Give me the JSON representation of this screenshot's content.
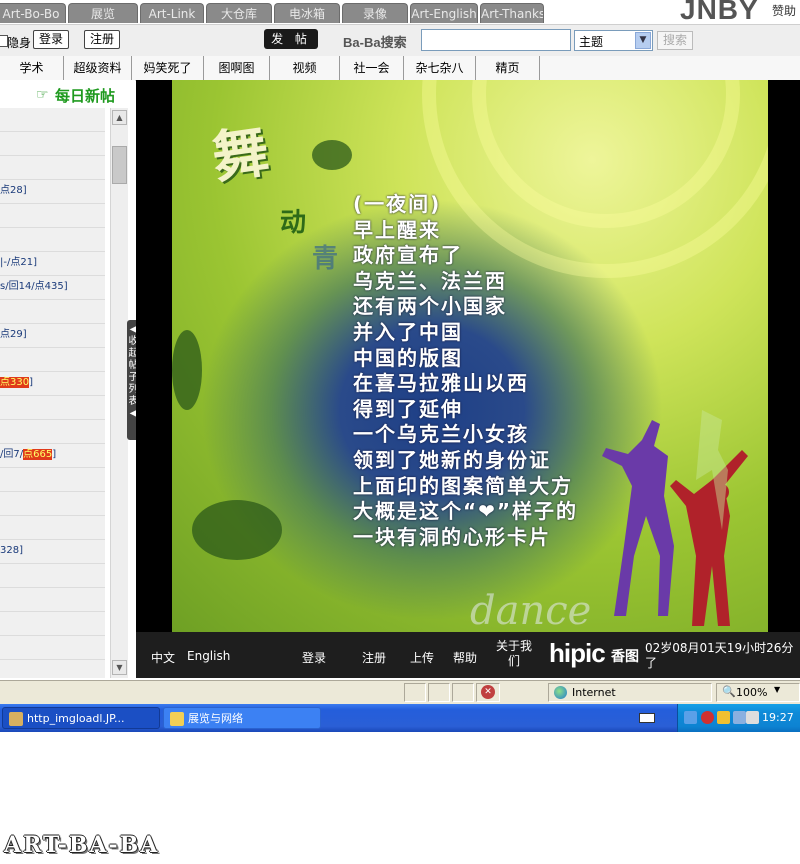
{
  "tabs": [
    "Art-Bo-Bo",
    "展览",
    "Art-Link",
    "大仓库",
    "电冰箱",
    "录像",
    "Art-English",
    "Art-Thanks"
  ],
  "brand": {
    "logo": "JNBY",
    "sponsor": "赞助"
  },
  "login_row": {
    "hidden_label": "隐身",
    "login_label": "登录",
    "register_label": "注册",
    "post_label": "发 帖",
    "search_label": "Ba-Ba搜索",
    "search_value": "",
    "scope_value": "主题",
    "search_button": "搜索"
  },
  "categories": [
    "学术",
    "超级资料",
    "妈笑死了",
    "图啊图",
    "视频",
    "社一会",
    "杂七杂八",
    "精页"
  ],
  "sidebar": {
    "title": "每日新帖",
    "collapse_label": "收起帖子列表",
    "posts": [
      {
        "text": "",
        "hl": ""
      },
      {
        "text": "",
        "hl": ""
      },
      {
        "text": "",
        "hl": ""
      },
      {
        "text": "点28]",
        "hl": ""
      },
      {
        "text": "",
        "hl": ""
      },
      {
        "text": "",
        "hl": ""
      },
      {
        "text": "|-/点21]",
        "hl": ""
      },
      {
        "text": "s/回14/点435]",
        "hl": ""
      },
      {
        "text": "",
        "hl": ""
      },
      {
        "text": "点29]",
        "hl": ""
      },
      {
        "text": "",
        "hl": ""
      },
      {
        "text": "",
        "hl": "点330",
        "tail": "]"
      },
      {
        "text": "",
        "hl": ""
      },
      {
        "text": "",
        "hl": ""
      },
      {
        "text": "/回7/",
        "hl": "点665",
        "tail": "]"
      },
      {
        "text": "",
        "hl": ""
      },
      {
        "text": "",
        "hl": ""
      },
      {
        "text": "",
        "hl": ""
      },
      {
        "text": "328]",
        "hl": ""
      },
      {
        "text": "",
        "hl": ""
      },
      {
        "text": "",
        "hl": ""
      },
      {
        "text": "",
        "hl": ""
      },
      {
        "text": "",
        "hl": ""
      },
      {
        "text": "",
        "hl": ""
      }
    ]
  },
  "artwork": {
    "title_big": "舞",
    "title_dong": "动",
    "title_qing": "青",
    "poem": [
      "(一夜间)",
      "早上醒来",
      "政府宣布了",
      "乌克兰、法兰西",
      "还有两个小国家",
      "并入了中国",
      "中国的版图",
      "在喜马拉雅山以西",
      "得到了延伸",
      "一个乌克兰小女孩",
      "领到了她新的身份证",
      "上面印的图案简单大方",
      "大概是这个“❤”样子的",
      "一块有洞的心形卡片"
    ],
    "watermark": "dance"
  },
  "viewer_footer": {
    "links": [
      "中文",
      "English",
      "登录",
      "注册",
      "上传",
      "帮助",
      "关于我们"
    ],
    "logo": "hipic",
    "logo_cn": "香图",
    "user_info": "02岁08月01天19小时26分了"
  },
  "statusbar": {
    "zone": "Internet",
    "zoom": "100%"
  },
  "taskbar": {
    "windows": [
      "http_imgloadl.JP...",
      "展览与网络"
    ],
    "clock": "19:27"
  },
  "page_watermark": "ART-BA-BA",
  "colors": {
    "tab_gray": "#8a8a8a",
    "highlight_red": "#e03a1a",
    "title_green": "#1f9a1f",
    "taskbar_blue": "#245edb"
  }
}
